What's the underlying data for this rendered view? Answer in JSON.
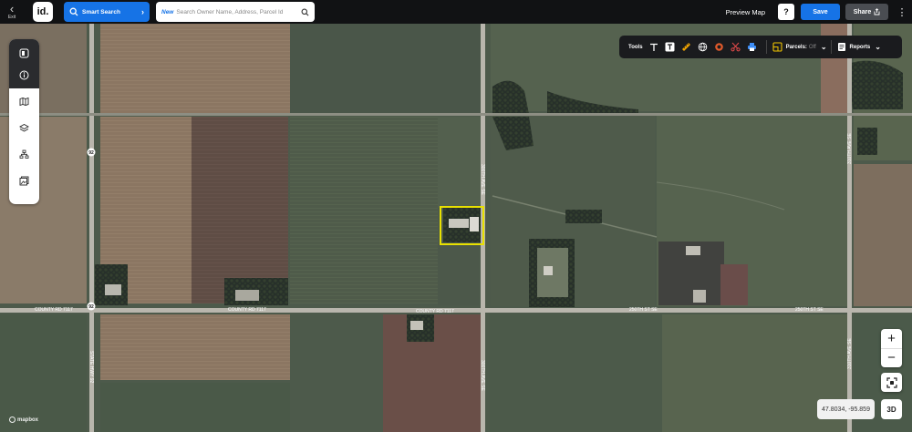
{
  "topbar": {
    "exit_label": "Exit",
    "logo_text": "id.",
    "smart_search_label": "Smart Search",
    "search_new_tag": "New",
    "search_placeholder": "Search Owner Name, Address, Parcel Id",
    "preview_label": "Preview Map",
    "help_label": "?",
    "save_label": "Save",
    "share_label": "Share",
    "menu_label": "⋮"
  },
  "left_panel": {
    "buttons": [
      "sidebar-toggle-icon",
      "info-icon",
      "map-icon",
      "layers-icon",
      "org-chart-icon",
      "image-layer-icon"
    ]
  },
  "toolbar": {
    "tools_label": "Tools",
    "tools": [
      "text-t-icon",
      "text-box-icon",
      "ruler-icon",
      "globe-icon",
      "circle-icon",
      "scissors-icon",
      "print-icon"
    ],
    "parcels_label": "Parcels:",
    "parcels_state": "Off",
    "reports_label": "Reports"
  },
  "map": {
    "road_labels": {
      "hwy_shield_top": "92",
      "hwy_shield_bottom": "92",
      "county_rd_left": "COUNTY RD 7117",
      "county_rd_mid_left": "COUNTY RD 7117",
      "county_rd_mid": "COUNTY RD 7117",
      "st_250_mid": "250TH ST SE",
      "st_250_right": "250TH ST SE",
      "ave_300_top": "300TH AVE SE",
      "ave_300_bottom": "300TH AVE SE",
      "ave_310_top": "310TH AVE SE",
      "ave_310_bottom": "310TH AVE SE",
      "state_hwy": "STATE HWY 92"
    },
    "attribution": "mapbox",
    "coordinates": "47.8034, -95.859",
    "zoom_in": "+",
    "zoom_out": "−",
    "three_d_label": "3D",
    "colors": {
      "selection": "#e8e000",
      "road": "#b9b6ad"
    }
  }
}
